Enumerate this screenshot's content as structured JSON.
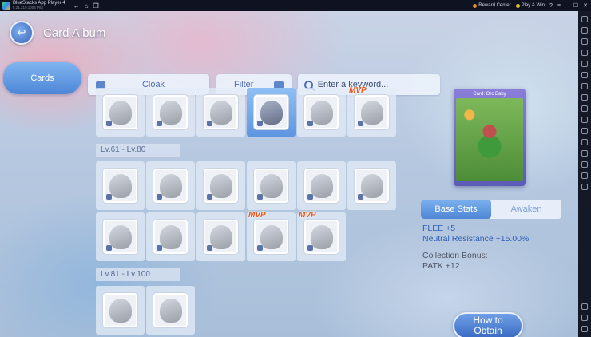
{
  "window": {
    "title": "BlueStacks App Player 4",
    "subtitle": "5.21.210.1003  P64",
    "reward_label": "Reward Center",
    "playwin_label": "Play & Win"
  },
  "header": {
    "title": "Card Album"
  },
  "nav": {
    "cards_tab": "Cards"
  },
  "toolbar": {
    "category": "Cloak",
    "filter": "Filter",
    "search_placeholder": "Enter a keyword..."
  },
  "sections": [
    {
      "label": "Lv.61 - Lv.80"
    },
    {
      "label": "Lv.81 - Lv.100"
    }
  ],
  "mvp_badge": "MVP",
  "preview": {
    "card_name": "Card: Orc Baby"
  },
  "detail_tabs": {
    "base": "Base Stats",
    "awaken": "Awaken"
  },
  "stats": {
    "flee": "FLEE +5",
    "neutral": "Neutral Resistance +15.00%",
    "bonus_label": "Collection Bonus:",
    "bonus_value": "PATK +12"
  },
  "obtain": {
    "line1": "How to",
    "line2": "Obtain"
  }
}
